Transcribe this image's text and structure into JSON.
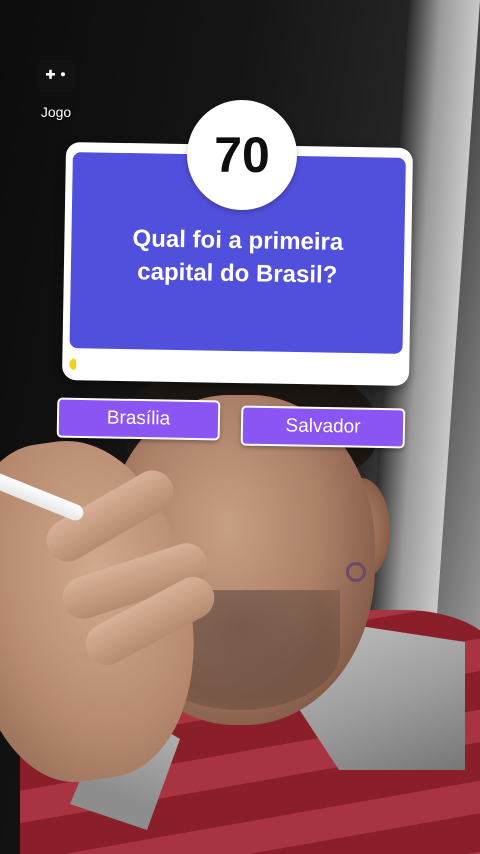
{
  "effect": {
    "label": "Jogo",
    "icon": "gamepad-icon"
  },
  "quiz": {
    "score": "70",
    "question": "Qual foi a primeira capital do Brasil?",
    "timer_progress": 0.02,
    "answers": [
      {
        "label": "Brasília"
      },
      {
        "label": "Salvador"
      }
    ]
  },
  "colors": {
    "question_panel": "#5050dc",
    "answer_button": "#8a55f2",
    "timer_fill": "#f2d21b",
    "card_background": "#ffffff"
  }
}
